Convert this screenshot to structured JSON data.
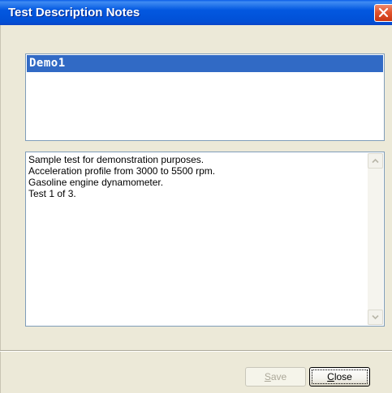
{
  "window": {
    "title": "Test Description Notes"
  },
  "list": {
    "items": [
      {
        "label": "Demo1",
        "selected": true
      }
    ]
  },
  "notes": {
    "lines": [
      "Sample test for demonstration purposes.",
      "Acceleration profile from 3000 to 5500 rpm.",
      "Gasoline engine dynamometer.",
      "Test 1 of 3."
    ]
  },
  "buttons": {
    "save_label": "Save",
    "save_mnemonic": "S",
    "close_label": "Close",
    "close_mnemonic": "C"
  },
  "colors": {
    "title_bar": "#0358e0",
    "selection": "#316ac5",
    "close_button": "#e2542d",
    "dialog_background": "#ece9d8"
  }
}
